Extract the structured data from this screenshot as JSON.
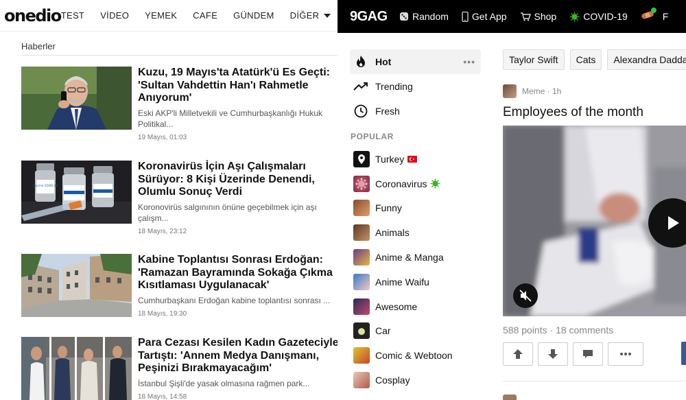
{
  "onedio": {
    "logo": "onedio",
    "nav": [
      "TEST",
      "VİDEO",
      "YEMEK",
      "CAFE",
      "GÜNDEM"
    ],
    "nav_more": "DİĞER",
    "section_title": "Haberler",
    "articles": [
      {
        "title": "Kuzu, 19 Mayıs'ta Atatürk'ü Es Geçti: 'Sultan Vahdettin Han'ı Rahmetle Anıyorum'",
        "desc": "Eski AKP'li Milletvekili ve Cumhurbaşkanlığı Hukuk Politikal...",
        "date": "19 Mayıs, 01:03"
      },
      {
        "title": "Koronavirüs İçin Aşı Çalışmaları Sürüyor: 8 Kişi Üzerinde Denendi, Olumlu Sonuç Verdi",
        "desc": "Koronovirüs salgınının önüne geçebilmek için aşı çalışm...",
        "date": "18 Mayıs, 23:12",
        "vial_label": "Vaccine COVID-19"
      },
      {
        "title": "Kabine Toplantısı Sonrası Erdoğan: 'Ramazan Bayramında Sokağa Çıkma Kısıtlaması Uygulanacak'",
        "desc": "Cumhurbaşkanı Erdoğan kabine toplantısı sonrası ...",
        "date": "18 Mayıs, 19:30"
      },
      {
        "title": "Para Cezası Kesilen Kadın Gazeteciyle Tartıştı: 'Annem Medya Danışmanı, Peşinizi Bırakmayacağım'",
        "desc": "İstanbul Şişli'de yasak olmasına rağmen park...",
        "date": "18 Mayıs, 14:58"
      }
    ]
  },
  "ninegag": {
    "logo": "9GAG",
    "nav": {
      "random": "Random",
      "get_app": "Get App",
      "shop": "Shop",
      "covid": "COVID-19",
      "cut": "F"
    },
    "side": {
      "hot": "Hot",
      "hot_more": "•••",
      "trending": "Trending",
      "fresh": "Fresh",
      "popular_header": "POPULAR",
      "popular": [
        {
          "label": "Turkey",
          "icon": "location-pin-icon",
          "badge": "turkey-flag-icon"
        },
        {
          "label": "Coronavirus",
          "icon": "virus-icon",
          "badge": "virus-icon"
        },
        {
          "label": "Funny",
          "icon": "funny-section-icon"
        },
        {
          "label": "Animals",
          "icon": "animals-section-icon"
        },
        {
          "label": "Anime & Manga",
          "icon": "anime-section-icon"
        },
        {
          "label": "Anime Waifu",
          "icon": "waifu-section-icon"
        },
        {
          "label": "Awesome",
          "icon": "awesome-section-icon"
        },
        {
          "label": "Car",
          "icon": "car-section-icon"
        },
        {
          "label": "Comic & Webtoon",
          "icon": "comic-section-icon"
        },
        {
          "label": "Cosplay",
          "icon": "cosplay-section-icon"
        }
      ]
    },
    "tags": [
      "Taylor Swift",
      "Cats",
      "Alexandra Daddario"
    ],
    "post": {
      "meta": "Meme · 1h",
      "title": "Employees of the month",
      "points": "588 points",
      "comments": "18 comments",
      "stats_separator": " · "
    }
  },
  "colors": {
    "onedio_bg": "#ffffff",
    "gag_bar": "#000000",
    "gag_accent_green": "#26c940",
    "facebook_blue": "#3b5998"
  }
}
